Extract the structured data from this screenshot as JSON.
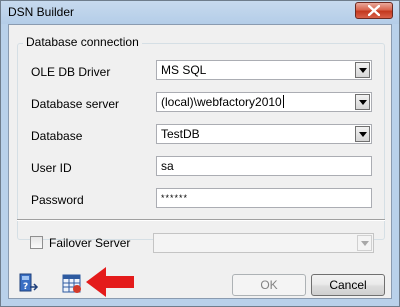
{
  "window": {
    "title": "DSN Builder"
  },
  "group": {
    "legend": "Database connection"
  },
  "form": {
    "driver": {
      "label": "OLE DB Driver",
      "value": "MS SQL"
    },
    "server": {
      "label": "Database server",
      "value": "(local)\\webfactory2010"
    },
    "database": {
      "label": "Database",
      "value": "TestDB"
    },
    "user": {
      "label": "User ID",
      "value": "sa"
    },
    "password": {
      "label": "Password",
      "value": "******"
    }
  },
  "failover": {
    "label": "Failover Server",
    "checked": false,
    "value": ""
  },
  "buttons": {
    "ok": "OK",
    "cancel": "Cancel"
  },
  "icons": [
    "help-connection-icon",
    "database-grid-icon",
    "red-arrow-annotation"
  ],
  "colors": {
    "close_button": "#c94a33",
    "arrow": "#e41b1b",
    "title_bg": "#bcd3ec"
  }
}
